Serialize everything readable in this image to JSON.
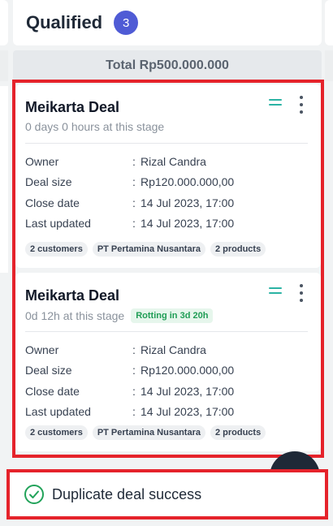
{
  "column": {
    "title": "Qualified",
    "count": "3",
    "total": "Total Rp500.000.000"
  },
  "cards": [
    {
      "title": "Meikarta Deal",
      "stage_time": "0 days 0 hours at this stage",
      "rotting": "",
      "fields": [
        {
          "label": "Owner",
          "value": "Rizal Candra"
        },
        {
          "label": "Deal size",
          "value": "Rp120.000.000,00"
        },
        {
          "label": "Close date",
          "value": "14 Jul 2023, 17:00"
        },
        {
          "label": "Last updated",
          "value": "14 Jul 2023, 17:00"
        }
      ],
      "tags": [
        "2 customers",
        "PT Pertamina Nusantara",
        "2 products"
      ]
    },
    {
      "title": "Meikarta Deal",
      "stage_time": "0d 12h at this stage",
      "rotting": "Rotting in 3d 20h",
      "fields": [
        {
          "label": "Owner",
          "value": "Rizal Candra"
        },
        {
          "label": "Deal size",
          "value": "Rp120.000.000,00"
        },
        {
          "label": "Close date",
          "value": "14 Jul 2023, 17:00"
        },
        {
          "label": "Last updated",
          "value": "14 Jul 2023, 17:00"
        }
      ],
      "tags": [
        "2 customers",
        "PT Pertamina Nusantara",
        "2 products"
      ]
    }
  ],
  "field_separator": ":",
  "toast": {
    "message": "Duplicate deal success"
  },
  "colors": {
    "accent": "#4f5bd5",
    "highlight": "#e5232b",
    "success": "#22a35a",
    "drag": "#2bb3a4"
  }
}
